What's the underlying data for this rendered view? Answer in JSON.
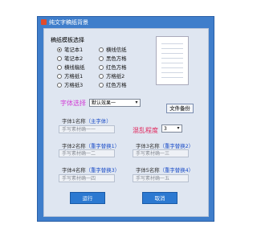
{
  "window": {
    "title": "纯文字稿纸背景"
  },
  "template_group": {
    "label": "稿纸模板选择",
    "options": [
      {
        "label": "笔记本1",
        "selected": true
      },
      {
        "label": "横线信纸",
        "selected": false
      },
      {
        "label": "笔记本2",
        "selected": false
      },
      {
        "label": "黑色方格",
        "selected": false
      },
      {
        "label": "横线稿纸",
        "selected": false
      },
      {
        "label": "红色方格",
        "selected": false
      },
      {
        "label": "方格纸1",
        "selected": false
      },
      {
        "label": "方格纸2",
        "selected": false
      },
      {
        "label": "方格纸3",
        "selected": false
      },
      {
        "label": "红色方格",
        "selected": false
      }
    ]
  },
  "font_select": {
    "label": "字体选择",
    "value": "默认效果一"
  },
  "file_backup_button": "文件备份",
  "mess_level": {
    "label": "混乱程度",
    "value": "3"
  },
  "fonts": [
    {
      "name_label": "字体1名称",
      "hint": "（主字体）",
      "placeholder": "手写素材确一一"
    },
    {
      "name_label": "字体2名称",
      "hint": "（重字替换1）",
      "placeholder": "手写素材确一二"
    },
    {
      "name_label": "字体3名称",
      "hint": "（重字替换2）",
      "placeholder": "手写素材确一三"
    },
    {
      "name_label": "字体4名称",
      "hint": "（重字替换3）",
      "placeholder": "手写素材确一四"
    },
    {
      "name_label": "字体5名称",
      "hint": "（重字替换4）",
      "placeholder": "手写素材确一五"
    }
  ],
  "run_button": "运行",
  "cancel_button": "取消"
}
